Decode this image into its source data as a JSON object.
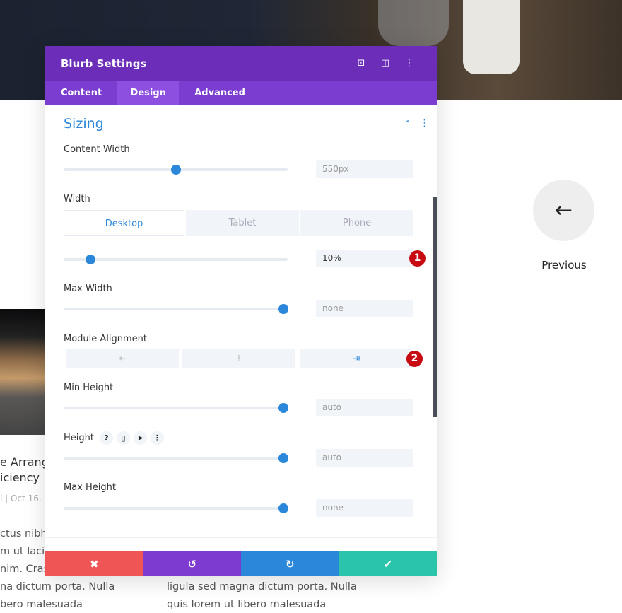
{
  "background": {
    "previous_label": "Previous",
    "post_title_lines": [
      "e Arrang",
      "iciency"
    ],
    "post_meta": "i | Oct 16, 2",
    "body_left": [
      "ctus nibh.",
      "m ut lacini",
      "nim. Cras",
      "na dictum porta. Nulla",
      "bero malesuada"
    ],
    "body_mid": [
      "ligula sed magna dictum porta. Nulla",
      "quis lorem ut libero malesuada"
    ]
  },
  "modal": {
    "title": "Blurb Settings",
    "header_icons": [
      "focus-icon",
      "split-view-icon",
      "more-vertical-icon"
    ],
    "tabs": [
      {
        "label": "Content"
      },
      {
        "label": "Design",
        "active": true
      },
      {
        "label": "Advanced"
      }
    ],
    "section_title": "Sizing",
    "fields": {
      "content_width": {
        "label": "Content Width",
        "value": "550px",
        "slider": 0.5
      },
      "width": {
        "label": "Width",
        "value": "10%",
        "slider": 0.12,
        "devices": [
          "Desktop",
          "Tablet",
          "Phone"
        ],
        "active_device": "Desktop"
      },
      "max_width": {
        "label": "Max Width",
        "value": "none",
        "slider": 0.98
      },
      "module_alignment": {
        "label": "Module Alignment",
        "options": [
          "left",
          "center",
          "right"
        ],
        "selected": "right"
      },
      "min_height": {
        "label": "Min Height",
        "value": "auto",
        "slider": 0.98
      },
      "height": {
        "label": "Height",
        "help": "?",
        "value": "auto",
        "slider": 0.98
      },
      "max_height": {
        "label": "Max Height",
        "value": "none",
        "slider": 0.98
      }
    },
    "badges": [
      "1",
      "2"
    ],
    "footer": {
      "cancel": "✖",
      "undo": "↺",
      "redo": "↻",
      "save": "✔"
    }
  },
  "colors": {
    "header": "#6c2eb9",
    "tabs": "#7b3dcf",
    "accent": "#2b87da",
    "cancel": "#ef5555",
    "undo": "#7e3bd0",
    "redo": "#2b87da",
    "save": "#29c4a9",
    "badge": "#c80a13"
  }
}
